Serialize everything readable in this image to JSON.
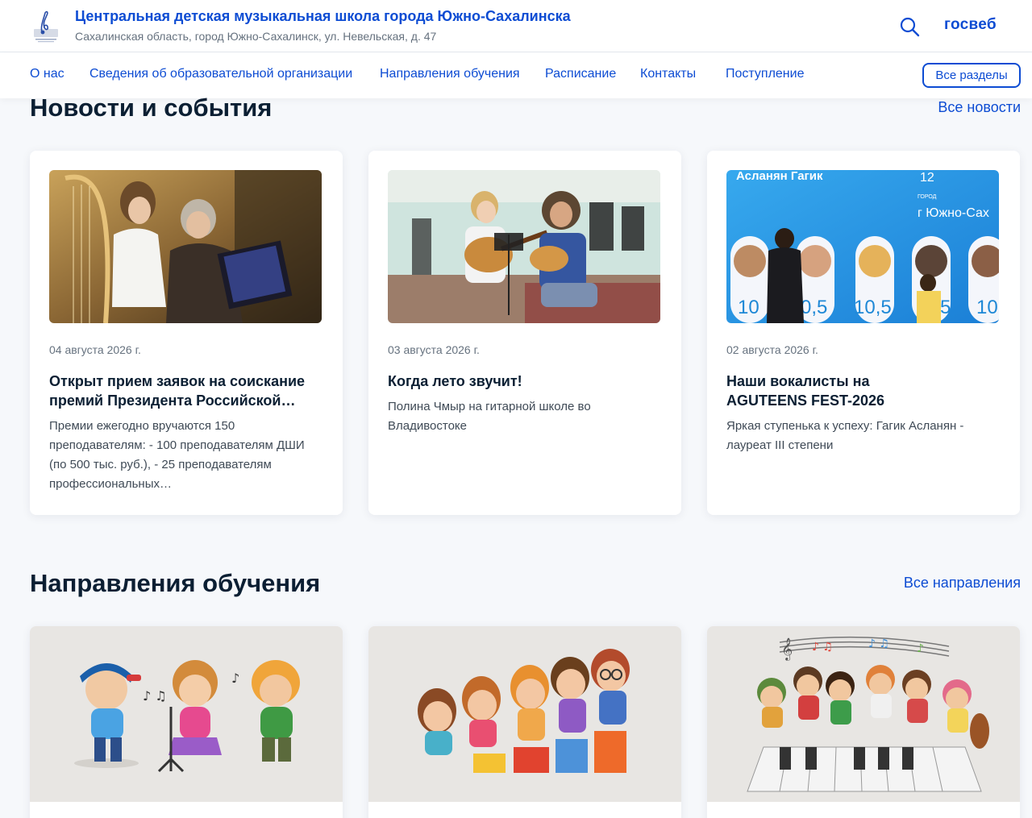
{
  "header": {
    "school_name": "Центральная детская музыкальная школа города Южно-Сахалинска",
    "address": "Сахалинская область, город Южно-Сахалинск, ул. Невельская, д. 47",
    "brand": "госвеб",
    "logo_icon": "music-school-logo-icon",
    "search_icon": "search-icon"
  },
  "nav": {
    "items": [
      {
        "label": "О нас"
      },
      {
        "label": "Сведения об образовательной организации"
      },
      {
        "label": "Направления обучения"
      },
      {
        "label": "Расписание"
      },
      {
        "label": "Контакты"
      },
      {
        "label": "Поступление"
      }
    ],
    "all_sections": "Все разделы"
  },
  "news": {
    "title": "Новости и события",
    "all_link": "Все новости",
    "items": [
      {
        "date": "04 августа 2026 г.",
        "title": "Открыт прием заявок на соискание премий Президента Российской…",
        "description": "Премии ежегодно вручаются 150 преподавателям: - 100 преподавателям ДШИ (по 500 тыс. руб.), - 25 преподавателям профессиональных…"
      },
      {
        "date": "03 августа 2026 г.",
        "title": "Когда лето звучит!",
        "description": "Полина Чмыр на гитарной школе во Владивостоке"
      },
      {
        "date": "02 августа 2026 г.",
        "title": "Наши вокалисты на AGUTEENS FEST-2026",
        "description": "Яркая ступенька к успеху: Гагик Асланян - лауреат III степени",
        "photo_text": {
          "name": "Асланян Гагик",
          "number": "12",
          "city_small": "ГОРОД",
          "city": "г Южно-Сах",
          "scores": [
            "10",
            "0,5",
            "10,5",
            "5",
            "10"
          ]
        }
      }
    ]
  },
  "directions": {
    "title": "Направления обучения",
    "all_link": "Все направления"
  },
  "colors": {
    "accent": "#0d4cd3",
    "text": "#0b1f33",
    "background": "#f6f8fb"
  }
}
